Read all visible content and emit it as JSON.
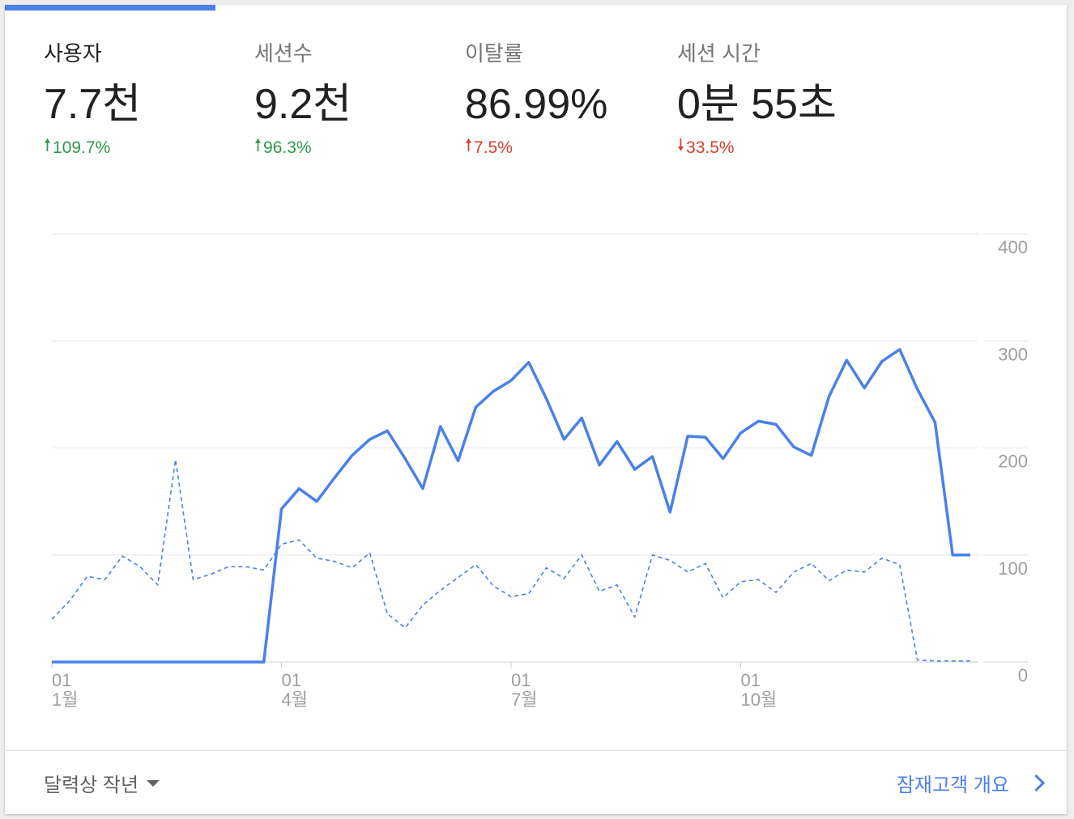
{
  "metrics": [
    {
      "label": "사용자",
      "value": "7.7천",
      "change": "109.7%",
      "direction": "up",
      "color": "#2e9a47",
      "active": true
    },
    {
      "label": "세션수",
      "value": "9.2천",
      "change": "96.3%",
      "direction": "up",
      "color": "#2e9a47",
      "active": false
    },
    {
      "label": "이탈률",
      "value": "86.99%",
      "change": "7.5%",
      "direction": "up",
      "color": "#d1402f",
      "active": false
    },
    {
      "label": "세션 시간",
      "value": "0분 55초",
      "change": "33.5%",
      "direction": "down",
      "color": "#d1402f",
      "active": false
    }
  ],
  "footer": {
    "date_range": "달력상 작년",
    "overview_link": "잠재고객 개요"
  },
  "colors": {
    "accent": "#4a80e8",
    "up": "#2e9a47",
    "down": "#d1402f"
  },
  "chart_data": {
    "type": "line",
    "ylim": [
      0,
      400
    ],
    "yticks": [
      0,
      100,
      200,
      300,
      400
    ],
    "grid": true,
    "x": [
      "01-01",
      "01-08",
      "01-15",
      "01-22",
      "01-29",
      "02-05",
      "02-12",
      "02-19",
      "02-26",
      "03-05",
      "03-12",
      "03-19",
      "03-26",
      "04-02",
      "04-09",
      "04-16",
      "04-23",
      "04-30",
      "05-07",
      "05-14",
      "05-21",
      "05-28",
      "06-04",
      "06-11",
      "06-18",
      "06-25",
      "07-02",
      "07-09",
      "07-16",
      "07-23",
      "07-30",
      "08-06",
      "08-13",
      "08-20",
      "08-27",
      "09-03",
      "09-10",
      "09-17",
      "09-24",
      "10-01",
      "10-08",
      "10-15",
      "10-22",
      "10-29",
      "11-05",
      "11-12",
      "11-19",
      "11-26",
      "12-03",
      "12-10",
      "12-17",
      "12-24",
      "12-31"
    ],
    "xticks": [
      {
        "day": "01",
        "month": "1월"
      },
      {
        "day": "01",
        "month": "4월"
      },
      {
        "day": "01",
        "month": "7월"
      },
      {
        "day": "01",
        "month": "10월"
      }
    ],
    "series": [
      {
        "style": "solid",
        "values": [
          0,
          0,
          0,
          0,
          0,
          0,
          0,
          0,
          0,
          0,
          0,
          0,
          0,
          143,
          162,
          150,
          172,
          193,
          208,
          216,
          190,
          162,
          220,
          188,
          238,
          253,
          263,
          280,
          246,
          208,
          228,
          184,
          206,
          180,
          192,
          140,
          211,
          210,
          190,
          214,
          225,
          222,
          201,
          193,
          248,
          282,
          256,
          281,
          292,
          255,
          224,
          100,
          100
        ]
      },
      {
        "style": "dashed",
        "values": [
          40,
          57,
          80,
          77,
          99,
          89,
          72,
          189,
          77,
          82,
          89,
          89,
          86,
          110,
          114,
          97,
          94,
          88,
          102,
          45,
          32,
          53,
          67,
          79,
          91,
          71,
          61,
          64,
          88,
          78,
          100,
          66,
          72,
          42,
          100,
          95,
          84,
          92,
          60,
          75,
          77,
          65,
          84,
          92,
          76,
          86,
          84,
          97,
          91,
          2,
          1,
          1,
          1
        ]
      }
    ]
  }
}
